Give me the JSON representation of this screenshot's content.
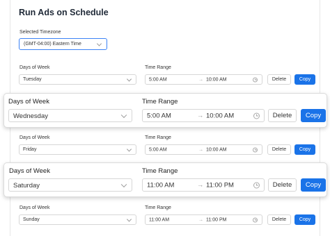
{
  "title": "Run Ads on Schedule",
  "timezone": {
    "label": "Selected Timezone",
    "value": "(GMT-04:00) Eastern Time"
  },
  "labels": {
    "days": "Days of Week",
    "time_range": "Time Range"
  },
  "buttons": {
    "delete": "Delete",
    "copy": "Copy"
  },
  "arrow": "→",
  "rows": [
    {
      "day": "Tuesday",
      "start": "5:00 AM",
      "end": "10:00 AM"
    },
    {
      "day": "Wednesday",
      "start": "5:00 AM",
      "end": "10:00 AM"
    },
    {
      "day": "Friday",
      "start": "5:00 AM",
      "end": "10:00 AM"
    },
    {
      "day": "Saturday",
      "start": "11:00 AM",
      "end": "11:00 PM"
    },
    {
      "day": "Sunday",
      "start": "11:00 AM",
      "end": "11:00 PM"
    }
  ],
  "colors": {
    "accent": "#1a73e8",
    "focus_border": "#3b82f6"
  }
}
